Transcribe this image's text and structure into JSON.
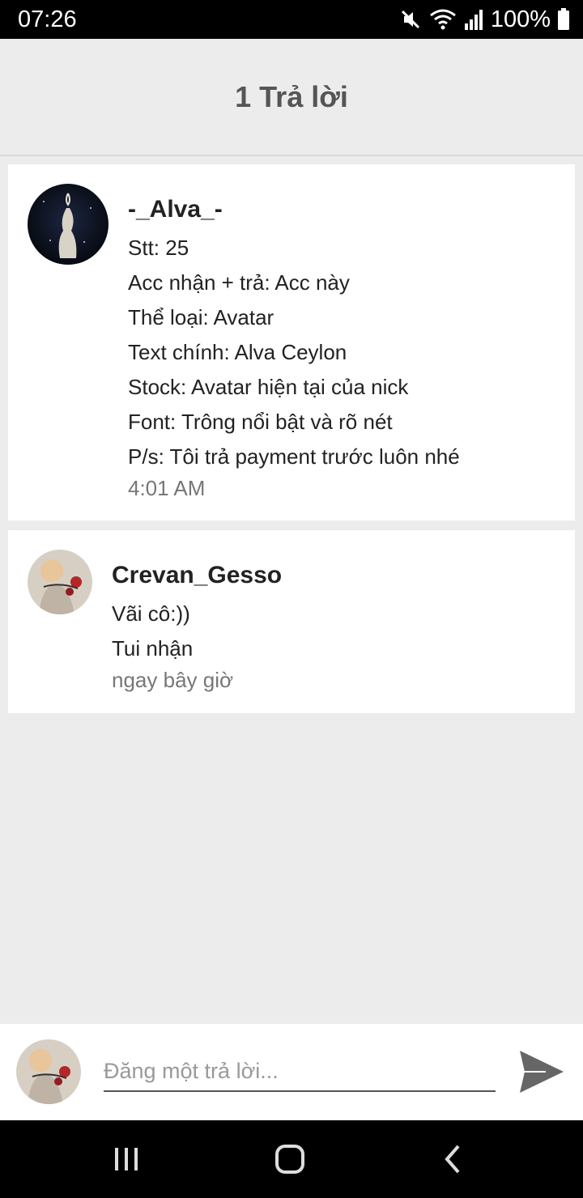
{
  "status_bar": {
    "time": "07:26",
    "battery": "100%",
    "icons": [
      "mute-icon",
      "wifi-icon",
      "signal-icon",
      "battery-icon"
    ]
  },
  "header": {
    "title": "1 Trả lời"
  },
  "posts": [
    {
      "username": "-_Alva_-",
      "lines": [
        "Stt: 25",
        "Acc nhận + trả: Acc này",
        "Thể loại: Avatar",
        "Text chính: Alva Ceylon",
        "Stock: Avatar hiện tại của nick",
        "Font: Trông nổi bật và rõ nét",
        "P/s: Tôi trả payment trước luôn nhé"
      ],
      "time": "4:01 AM"
    },
    {
      "username": "Crevan_Gesso",
      "lines": [
        "Vãi cô:))",
        "Tui nhận"
      ],
      "time": "ngay bây giờ"
    }
  ],
  "reply": {
    "placeholder": "Đăng một trả lời..."
  },
  "nav": {
    "icons": [
      "recent-apps-icon",
      "home-icon",
      "back-icon"
    ]
  },
  "colors": {
    "background": "#ececec",
    "card": "#ffffff",
    "muted_text": "#777777",
    "send_icon": "#666666"
  }
}
